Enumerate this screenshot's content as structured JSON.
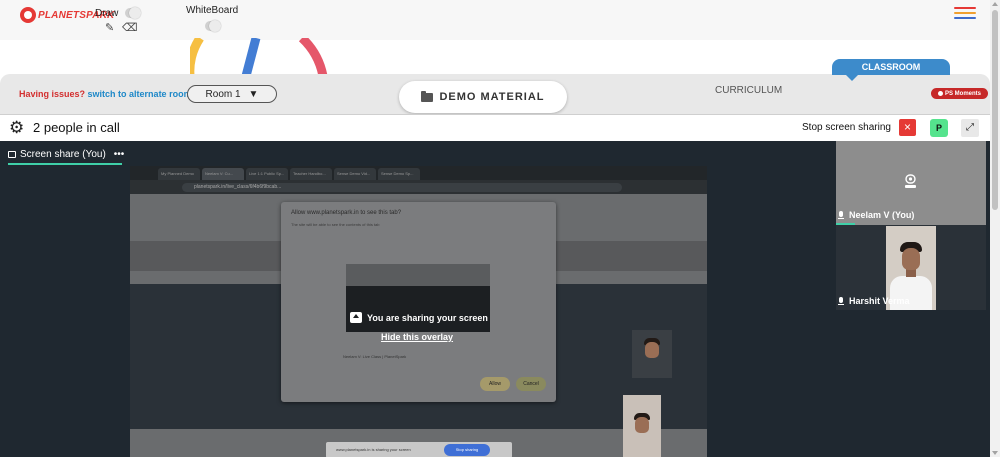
{
  "toolbar": {
    "logo_text": "PLANETSPARK",
    "draw_label": "Draw",
    "whiteboard_label": "WhiteBoard"
  },
  "infobar": {
    "issue_text": "Having issues?",
    "switch_link": "switch to alternate room",
    "room_value": "Room 1",
    "demo_material_label": "DEMO MATERIAL",
    "curriculum_tab": "CURRICULUM",
    "classroom_tab": "CLASSROOM",
    "ps_moments": "PS Moments"
  },
  "call": {
    "people_count": "2 people in call",
    "stop_sharing_label": "Stop screen sharing",
    "stop_icon": "×",
    "presenter_avatar": "P"
  },
  "screen_share": {
    "tab_label": "Screen share (You)",
    "more_icon": "•••",
    "overlay_text": "You are sharing your screen",
    "hide_overlay_link": "Hide this overlay",
    "shared_screen": {
      "browser_tabs": [
        "My Planned Demo",
        "Neelam V: Cu...",
        "Live 1:1 Public Sp...",
        "Teacher Handbo...",
        "Sense Demo Vid...",
        "Sense Demo Sp..."
      ],
      "address": "planetspark.in/live_class/6f4b6f9bcab...",
      "dialog_title": "Allow www.planetspark.in to see this tab?",
      "dialog_subtitle": "The site will be able to see the contents of this tab",
      "dialog_entry": "Neelam V: Live Class | PlanetSpark",
      "allow_label": "Allow",
      "cancel_label": "Cancel",
      "bottom_text": "www.planetspark.in is sharing your screen",
      "bottom_button": "Stop sharing"
    }
  },
  "participants": [
    {
      "name": "Neelam V (You)",
      "camera": "off"
    },
    {
      "name": "Harshit Verma",
      "camera": "on"
    }
  ],
  "colors": {
    "brand_red": "#e53935",
    "accent_blue": "#3d8bcb",
    "active_green": "#3fd0a8",
    "avatar_green": "#55e38d",
    "meeting_bg": "#1f2830"
  },
  "icons": {
    "settings": "gear-icon",
    "pencil": "pencil-icon",
    "eraser": "eraser-icon",
    "menu": "hamburger-menu-icon",
    "folder": "folder-icon",
    "expand": "expand-icon",
    "camera_off": "camera-off-icon",
    "mic": "mic-icon"
  }
}
